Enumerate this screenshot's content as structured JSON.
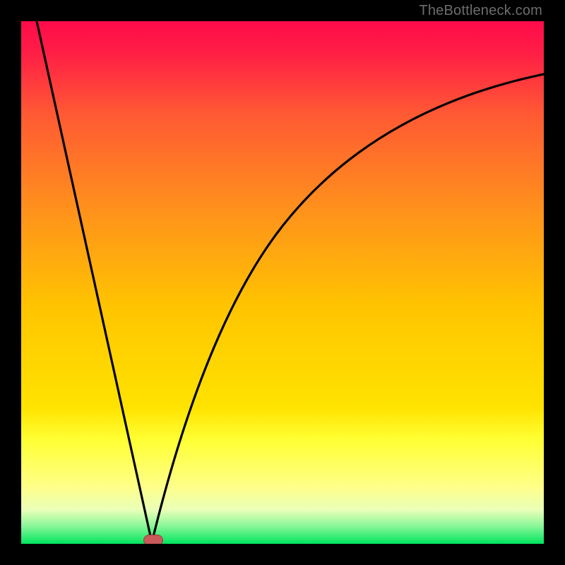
{
  "watermark": {
    "text": "TheBottleneck.com"
  },
  "colors": {
    "top": "#ff0b4a",
    "mid_upper": "#ff7a2a",
    "mid": "#ffd400",
    "lower_band": "#ffff66",
    "bottom": "#00e55e",
    "curve": "#000000",
    "marker": "#c85a5a"
  },
  "chart_data": {
    "type": "line",
    "title": "",
    "xlabel": "",
    "ylabel": "",
    "xlim": [
      0,
      100
    ],
    "ylim": [
      0,
      100
    ],
    "series": [
      {
        "name": "left-limb",
        "x": [
          3,
          25
        ],
        "values": [
          100,
          0
        ]
      },
      {
        "name": "right-limb",
        "x": [
          25,
          30,
          35,
          40,
          45,
          50,
          55,
          60,
          65,
          70,
          75,
          80,
          85,
          90,
          95,
          100
        ],
        "values": [
          0,
          16,
          31,
          43,
          53,
          61,
          68,
          73,
          77,
          80,
          83,
          85,
          86.5,
          88,
          89,
          90
        ]
      }
    ],
    "annotations": [
      {
        "name": "minimum-marker",
        "x": 25,
        "y": 0
      }
    ],
    "legend": false,
    "grid": false
  }
}
